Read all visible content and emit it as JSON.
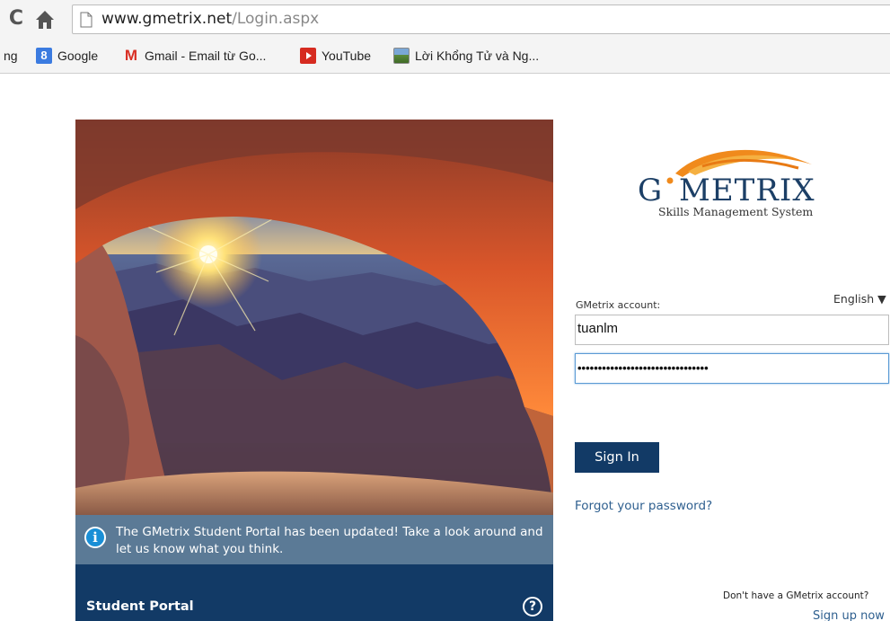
{
  "browser": {
    "url_domain": "www.gmetrix.net",
    "url_path": "/Login.aspx",
    "bookmarks": [
      {
        "label": "ng",
        "icon": "truncated"
      },
      {
        "label": "Google",
        "icon": "google-icon"
      },
      {
        "label": "Gmail - Email từ Go...",
        "icon": "gmail-icon"
      },
      {
        "label": "YouTube",
        "icon": "youtube-icon"
      },
      {
        "label": "Lời Khổng Tử và Ng...",
        "icon": "image-icon"
      }
    ]
  },
  "notice": {
    "text": "The GMetrix Student Portal has been updated! Take a look around and let us know what you think."
  },
  "portal": {
    "title": "Student Portal",
    "help": "?"
  },
  "logo": {
    "g": "G",
    "metrix": "METRIX",
    "subtitle": "Skills Management System"
  },
  "login": {
    "account_label": "GMetrix account:",
    "language": "English ▼",
    "username": "tuanlm",
    "password_mask": "••••••••••••••••••••••••••••••••",
    "signin": "Sign In",
    "forgot": "Forgot your password?",
    "no_account": "Don't have a GMetrix account?",
    "signup": "Sign up now"
  },
  "colors": {
    "brand_navy": "#123a66",
    "notice_bg": "#5b7a96",
    "link": "#2e5f8f",
    "logo_orange": "#f08a1c"
  }
}
